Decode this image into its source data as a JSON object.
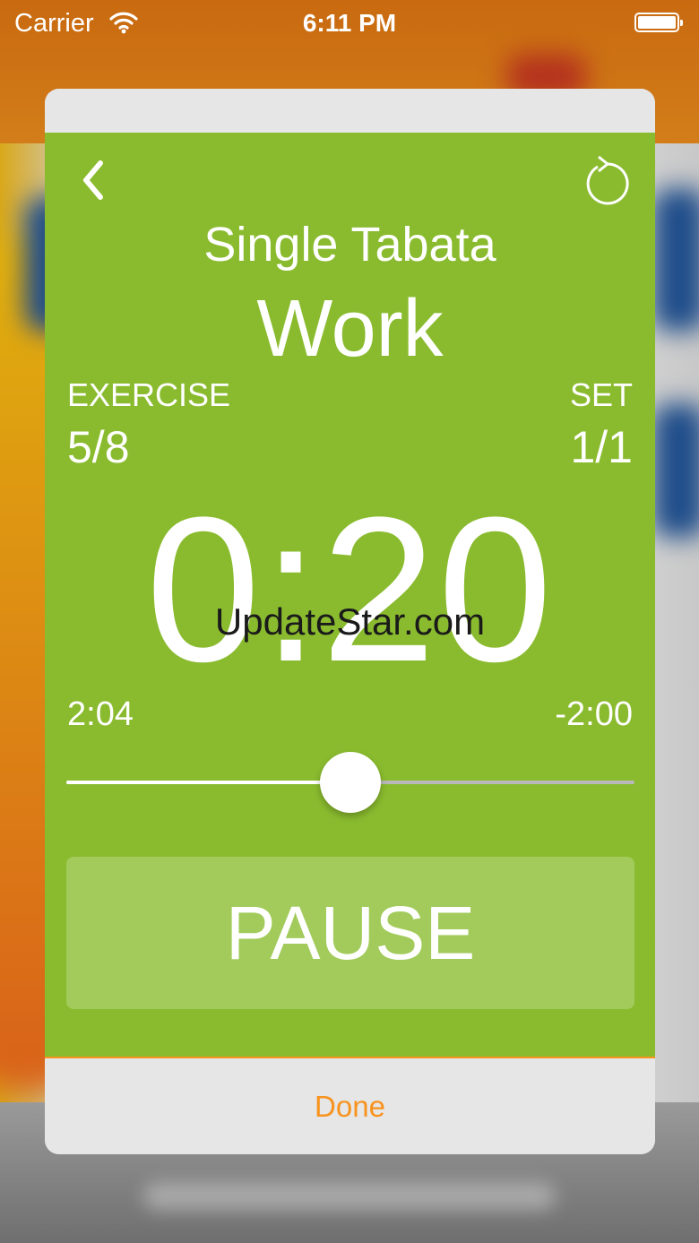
{
  "status_bar": {
    "carrier": "Carrier",
    "time": "6:11 PM"
  },
  "workout": {
    "title": "Single Tabata",
    "phase": "Work",
    "exercise_label": "EXERCISE",
    "exercise_value": "5/8",
    "set_label": "SET",
    "set_value": "1/1",
    "timer": "0:20",
    "elapsed": "2:04",
    "remaining": "-2:00",
    "progress": 0.5,
    "pause_label": "PAUSE"
  },
  "watermark": "UpdateStar.com",
  "footer": {
    "done_label": "Done"
  },
  "colors": {
    "panel_green": "#8abb2f",
    "pause_green": "#a2cb5b",
    "accent_orange": "#f7931e"
  },
  "icons": {
    "back": "chevron-left-icon",
    "reset": "reset-icon",
    "wifi": "wifi-icon",
    "battery": "battery-icon"
  }
}
